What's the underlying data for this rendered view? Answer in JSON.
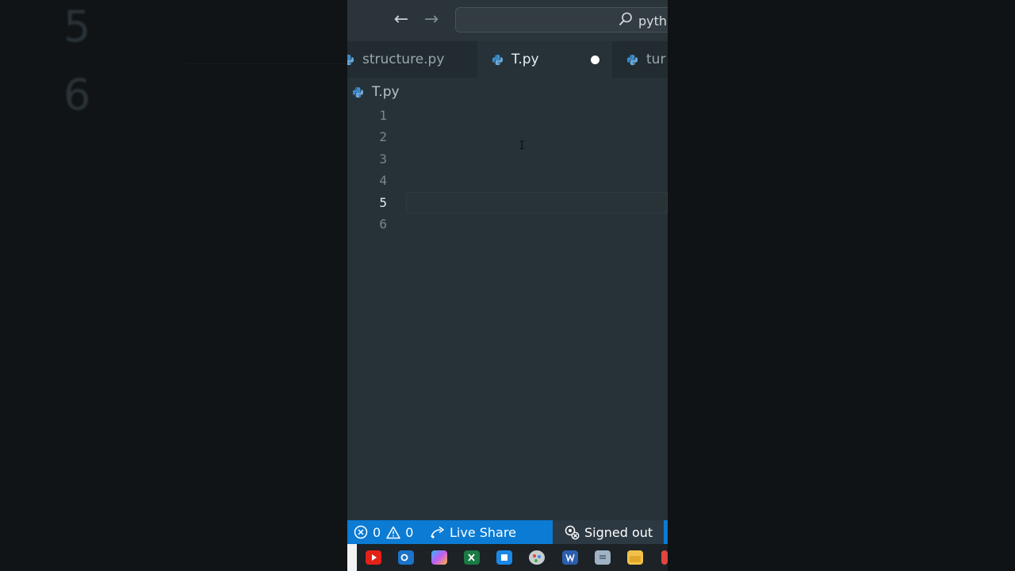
{
  "background": {
    "ghost_line_numbers": [
      "5",
      "6"
    ]
  },
  "titlebar": {
    "back_icon": "arrow-left-icon",
    "forward_icon": "arrow-right-icon",
    "search_text": "pyth"
  },
  "tabs": [
    {
      "label": "structure.py",
      "active": false,
      "icon": "python-icon"
    },
    {
      "label": "T.py",
      "active": true,
      "dirty": true,
      "icon": "python-icon"
    },
    {
      "label": "tur",
      "active": false,
      "icon": "python-icon"
    }
  ],
  "breadcrumb": {
    "file": "T.py",
    "icon": "python-icon"
  },
  "editor": {
    "line_numbers": [
      "1",
      "2",
      "3",
      "4",
      "5",
      "6"
    ],
    "current_line": "5",
    "cursor_glyph": "I"
  },
  "statusbar": {
    "errors": "0",
    "warnings": "0",
    "live_share": "Live Share",
    "account": "Signed out"
  },
  "taskbar": {
    "apps": [
      "youtube",
      "outlook",
      "copilot",
      "excel",
      "app-store",
      "paint",
      "word",
      "notepad",
      "file-explorer"
    ]
  },
  "colors": {
    "editor_bg": "#263238",
    "status_blue": "#0b7bd4",
    "python_blue": "#3b8ed0"
  }
}
